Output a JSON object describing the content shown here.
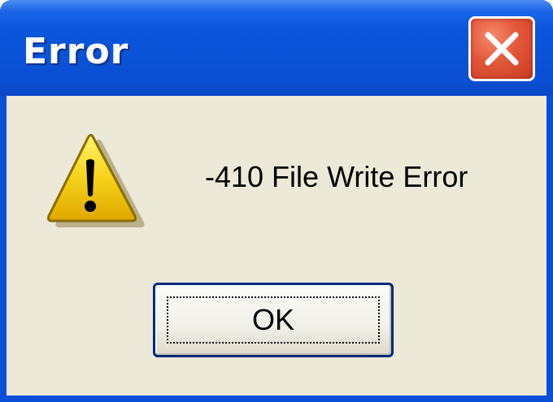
{
  "window": {
    "title": "Error",
    "close_icon": "close-x-icon",
    "title_bar_color": "#0a52d6",
    "close_button_color": "#e2573a",
    "body_color": "#ece9d8"
  },
  "dialog": {
    "icon": "warning-icon",
    "icon_color": "#f5d21a",
    "message": "-410 File Write Error",
    "ok_label": "OK"
  }
}
